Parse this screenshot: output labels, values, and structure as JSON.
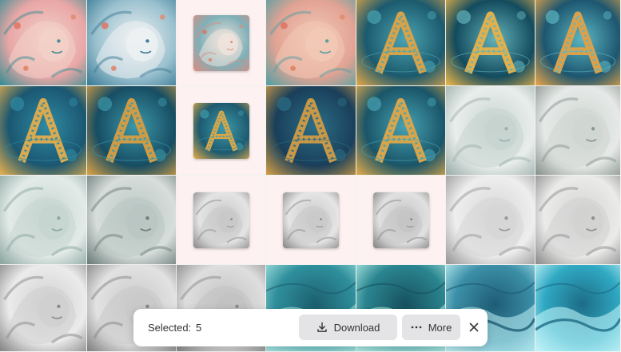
{
  "selection_bar": {
    "selected_label": "Selected:",
    "selected_count": "5",
    "download_label": "Download",
    "more_label": "More",
    "icons": {
      "download": "download-icon",
      "more": "more-horizontal-icon",
      "close": "close-icon"
    }
  },
  "gallery": {
    "columns": 7,
    "rows": 4,
    "selected_cells": [
      2,
      9,
      16,
      17,
      18
    ],
    "tiles": [
      {
        "subject": "lion-pink",
        "palette": [
          "#e8a7a6",
          "#3f8e93",
          "#f3d1c8"
        ]
      },
      {
        "subject": "lion-blue",
        "palette": [
          "#9bc1cf",
          "#3d7e98",
          "#eef1f2"
        ]
      },
      {
        "subject": "lion-blue-thumb",
        "palette": [
          "#7fb0b8",
          "#d68e82",
          "#f0e3dc"
        ]
      },
      {
        "subject": "lion-coral",
        "palette": [
          "#e2a394",
          "#5aa0a1",
          "#f2c9b7"
        ]
      },
      {
        "subject": "letter-a-cosmic",
        "palette": [
          "#1c5a6e",
          "#d6a24a",
          "#4aa4b1"
        ]
      },
      {
        "subject": "letter-a-cosmic",
        "palette": [
          "#134b5e",
          "#e0b04c",
          "#63b2b9"
        ]
      },
      {
        "subject": "letter-a-cosmic",
        "palette": [
          "#1d5670",
          "#dca04a",
          "#5bb6c2"
        ]
      },
      {
        "subject": "letter-a-map",
        "palette": [
          "#1b5771",
          "#d9aa4f",
          "#2f8aa3"
        ]
      },
      {
        "subject": "letter-a-map",
        "palette": [
          "#174d63",
          "#cf9c45",
          "#3c97a8"
        ]
      },
      {
        "subject": "letter-a-thumb",
        "palette": [
          "#1d5a6f",
          "#d9a648",
          "#3e9aab"
        ]
      },
      {
        "subject": "letter-a-map",
        "palette": [
          "#1a3f5a",
          "#c99847",
          "#2b6e86"
        ]
      },
      {
        "subject": "letter-a-map",
        "palette": [
          "#1a5568",
          "#d7a54b",
          "#46a2b3"
        ]
      },
      {
        "subject": "lion-white",
        "palette": [
          "#e9eeec",
          "#9fb1ad",
          "#c6d3cf"
        ]
      },
      {
        "subject": "lion-white",
        "palette": [
          "#e6e9e7",
          "#8c9691",
          "#cfd6d2"
        ]
      },
      {
        "subject": "lion-white",
        "palette": [
          "#e3ebe8",
          "#8ea8a2",
          "#c6d5d0"
        ]
      },
      {
        "subject": "lion-white",
        "palette": [
          "#d7dedc",
          "#6f807c",
          "#b9c6c2"
        ]
      },
      {
        "subject": "lion-white-thumb",
        "palette": [
          "#e3e4e3",
          "#8d8d8d",
          "#c8c8c8"
        ]
      },
      {
        "subject": "lion-white-thumb",
        "palette": [
          "#e4e5e4",
          "#8b8b8b",
          "#c9c9c9"
        ]
      },
      {
        "subject": "lion-white-thumb",
        "palette": [
          "#e0e1e0",
          "#878787",
          "#c4c4c4"
        ]
      },
      {
        "subject": "lion-white",
        "palette": [
          "#eeeeee",
          "#9a9a9a",
          "#d6d6d6"
        ]
      },
      {
        "subject": "lion-white",
        "palette": [
          "#ebebea",
          "#909090",
          "#d2d2d1"
        ]
      },
      {
        "subject": "lion-white",
        "palette": [
          "#ebebeb",
          "#8a8a8a",
          "#d0d0d0"
        ]
      },
      {
        "subject": "lion-white",
        "palette": [
          "#e2e2e2",
          "#858585",
          "#c9c9c9"
        ]
      },
      {
        "subject": "lion-white",
        "palette": [
          "#dedede",
          "#8b8b8b",
          "#c2c2c2"
        ]
      },
      {
        "subject": "teal-waves",
        "palette": [
          "#2f8f9c",
          "#9ee0dc",
          "#1c5f6f"
        ]
      },
      {
        "subject": "teal-waves",
        "palette": [
          "#2a8590",
          "#a8e6df",
          "#17515f"
        ]
      },
      {
        "subject": "teal-waves",
        "palette": [
          "#3c8fa8",
          "#b5e9ef",
          "#1e5c74"
        ]
      },
      {
        "subject": "teal-waves",
        "palette": [
          "#30a9c3",
          "#bdf1f6",
          "#1d6c86"
        ]
      }
    ]
  }
}
